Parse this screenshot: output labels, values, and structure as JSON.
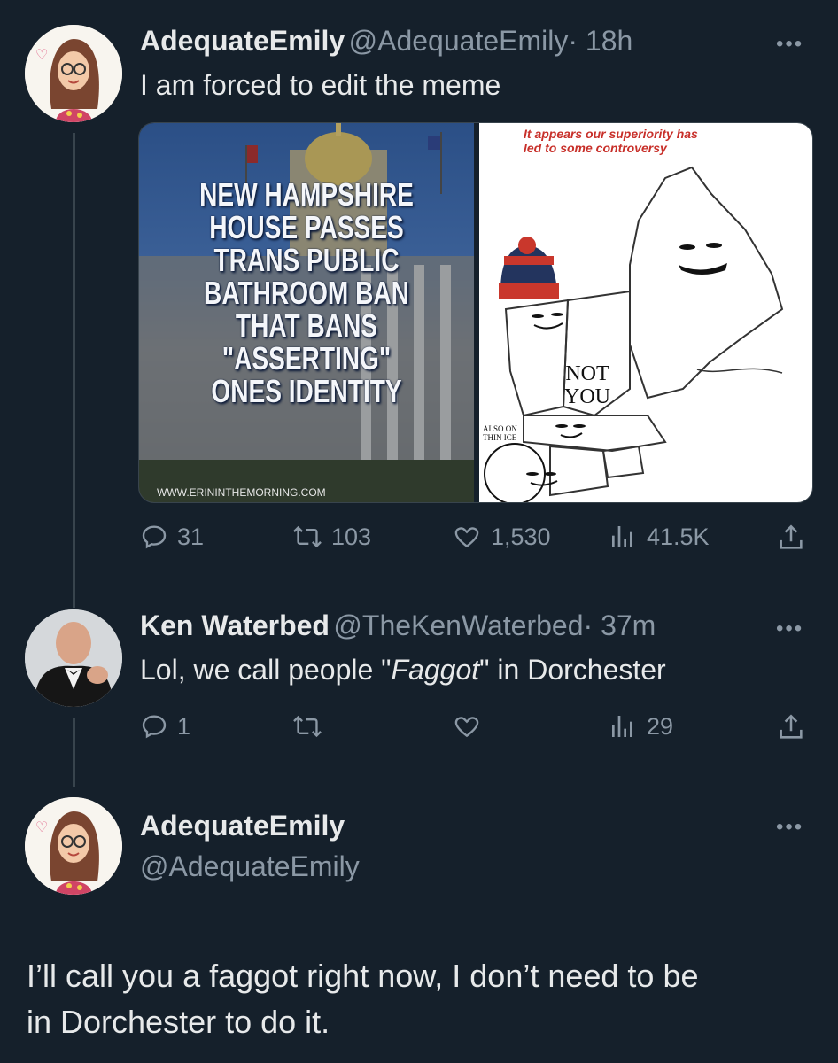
{
  "tweet1": {
    "name": "AdequateEmily",
    "handle": "@AdequateEmily",
    "time": "· 18h",
    "text": "I am forced to edit the meme",
    "more": "•••",
    "media_left": {
      "headline_lines": [
        "NEW HAMPSHIRE",
        "HOUSE PASSES",
        "TRANS PUBLIC",
        "BATHROOM BAN",
        "THAT BANS",
        "\"ASSERTING\"",
        "ONES IDENTITY"
      ],
      "watermark": "WWW.ERININTHEMORNING.COM"
    },
    "media_right": {
      "caption_line1": "It appears our superiority has",
      "caption_line2": "led to some controversy",
      "not_you_line1": "NOT",
      "not_you_line2": "YOU",
      "also_line1": "ALSO ON",
      "also_line2": "THIN ICE"
    },
    "stats": {
      "replies": "31",
      "retweets": "103",
      "likes": "1,530",
      "views": "41.5K"
    }
  },
  "tweet2": {
    "name": "Ken Waterbed",
    "handle": "@TheKenWaterbed",
    "time": "· 37m",
    "text_before": "Lol, we call people \"",
    "text_italic": "Faggot",
    "text_after": "\" in Dorchester",
    "more": "•••",
    "stats": {
      "replies": "1",
      "views": "29"
    }
  },
  "tweet3": {
    "name": "AdequateEmily",
    "handle": "@AdequateEmily",
    "more": "•••",
    "text_line1": "I’ll call you a faggot right now, I don’t need to be",
    "text_line2": "in Dorchester to do it."
  },
  "colors": {
    "background": "#15202b",
    "secondary_text": "#8b98a5",
    "thread_line": "#38444d"
  },
  "icons": [
    "reply-icon",
    "retweet-icon",
    "like-icon",
    "views-icon",
    "share-icon",
    "more-icon"
  ]
}
